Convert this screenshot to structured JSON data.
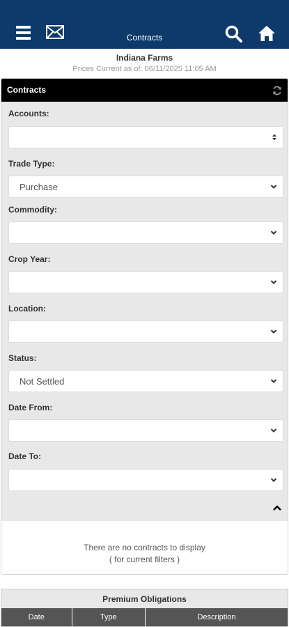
{
  "topbar": {
    "title": "Contracts",
    "icons": [
      "menu-icon",
      "mail-icon",
      "search-icon",
      "home-icon"
    ],
    "background": "#0d3a6b"
  },
  "header": {
    "org_name": "Indiana Farms",
    "prices_current": "Prices Current as of: 06/11/2025 11:05 AM"
  },
  "panel": {
    "title": "Contracts",
    "filters": [
      {
        "label": "Accounts:",
        "value": "",
        "control": "spinner"
      },
      {
        "label": "Trade Type:",
        "value": "Purchase",
        "control": "dropdown"
      },
      {
        "label": "Commodity:",
        "value": "",
        "control": "dropdown"
      },
      {
        "label": "Crop Year:",
        "value": "",
        "control": "dropdown"
      },
      {
        "label": "Location:",
        "value": "",
        "control": "dropdown"
      },
      {
        "label": "Status:",
        "value": "Not Settled",
        "control": "dropdown"
      },
      {
        "label": "Date From:",
        "value": "",
        "control": "dropdown"
      },
      {
        "label": "Date To:",
        "value": "",
        "control": "dropdown"
      }
    ],
    "empty_line1": "There are no contracts to display",
    "empty_line2": "( for current filters )"
  },
  "premium": {
    "title": "Premium Obligations",
    "columns": [
      "Date",
      "Type",
      "Description"
    ]
  }
}
